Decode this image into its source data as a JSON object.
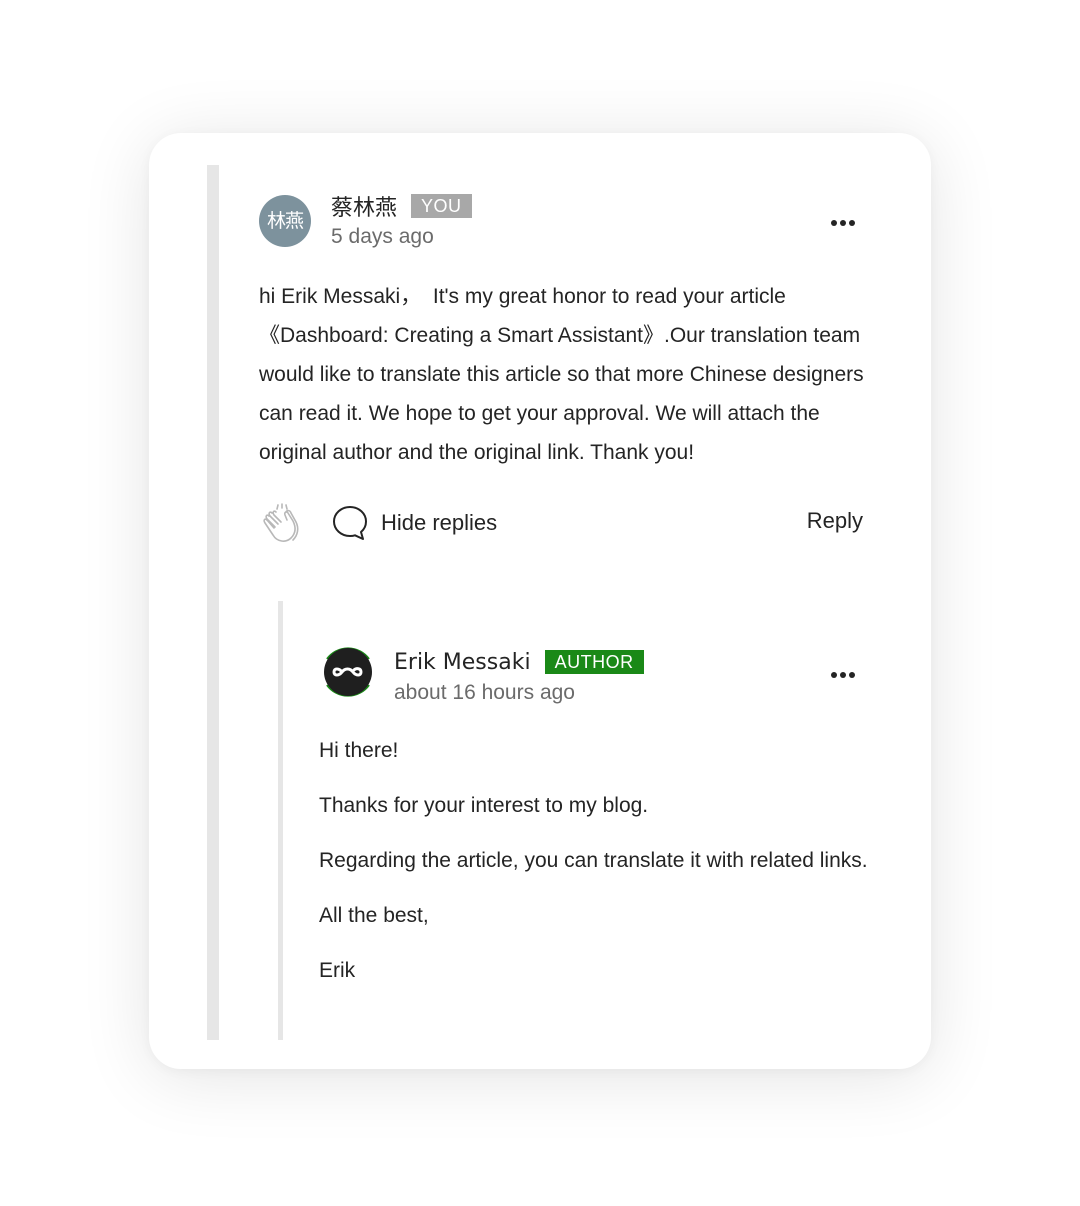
{
  "comment": {
    "avatar_text": "林燕",
    "author": "蔡林燕",
    "badge": "YOU",
    "time": "5 days ago",
    "body": "hi Erik Messaki，  It's my great honor to read your article\n《Dashboard: Creating a Smart Assistant》.Our translation team would like to translate this article so that more Chinese designers can read it. We hope to get your approval. We will attach the original author and the original link. Thank you!",
    "hide_replies_label": "Hide replies",
    "reply_label": "Reply"
  },
  "reply": {
    "author": "Erik Messaki",
    "badge": "AUTHOR",
    "time": "about 16 hours ago",
    "paragraphs": [
      "Hi there!",
      "Thanks for your interest to my blog.",
      "Regarding the article, you can translate it with related links.",
      "All the best,",
      "Erik"
    ]
  },
  "colors": {
    "author_badge": "#1a8917",
    "you_badge": "#a8a8a8",
    "avatar_bg": "#7d929d"
  },
  "icons": [
    "clap-icon",
    "comment-bubble-icon",
    "more-options-icon"
  ]
}
